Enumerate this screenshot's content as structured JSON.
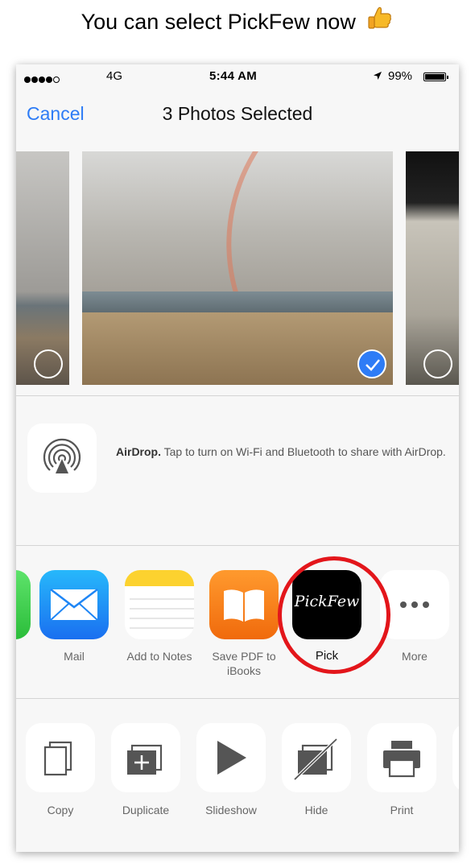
{
  "caption": {
    "text": "You can select PickFew now"
  },
  "status_bar": {
    "carrier": "4G",
    "time": "5:44 AM",
    "battery": "99%"
  },
  "nav": {
    "cancel_label": "Cancel",
    "title": "3 Photos Selected"
  },
  "airdrop": {
    "title": "AirDrop.",
    "description": "Tap to turn on Wi-Fi and Bluetooth to share with AirDrop."
  },
  "apps": [
    {
      "label": "Mail"
    },
    {
      "label": "Add to Notes"
    },
    {
      "label": "Save PDF to iBooks"
    },
    {
      "label": "Pick",
      "logo_text": "PickFew"
    },
    {
      "label": "More"
    }
  ],
  "actions": [
    {
      "label": "Copy"
    },
    {
      "label": "Duplicate"
    },
    {
      "label": "Slideshow"
    },
    {
      "label": "Hide"
    },
    {
      "label": "Print"
    }
  ],
  "colors": {
    "accent": "#2e7cf6",
    "highlight": "#e3161b"
  }
}
